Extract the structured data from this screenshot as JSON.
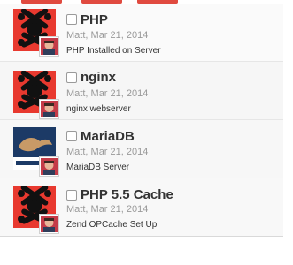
{
  "colors": {
    "accent_red": "#e04a3f",
    "text_dark": "#333333",
    "text_muted": "#9a9a9a"
  },
  "items": [
    {
      "title": "PHP",
      "author": "Matt",
      "date": "Mar 21, 2014",
      "description": "PHP Installed on Server",
      "icon": "red-skull-bones-icon"
    },
    {
      "title": "nginx",
      "author": "Matt",
      "date": "Mar 21, 2014",
      "description": "nginx webserver",
      "icon": "red-skull-bones-icon"
    },
    {
      "title": "MariaDB",
      "author": "Matt",
      "date": "Mar 21, 2014",
      "description": "MariaDB Server",
      "icon": "mariadb-foundation-logo-icon"
    },
    {
      "title": "PHP 5.5 Cache",
      "author": "Matt",
      "date": "Mar 21, 2014",
      "description": "Zend OPCache Set Up",
      "icon": "red-skull-bones-icon"
    }
  ],
  "meta_separator": ", "
}
